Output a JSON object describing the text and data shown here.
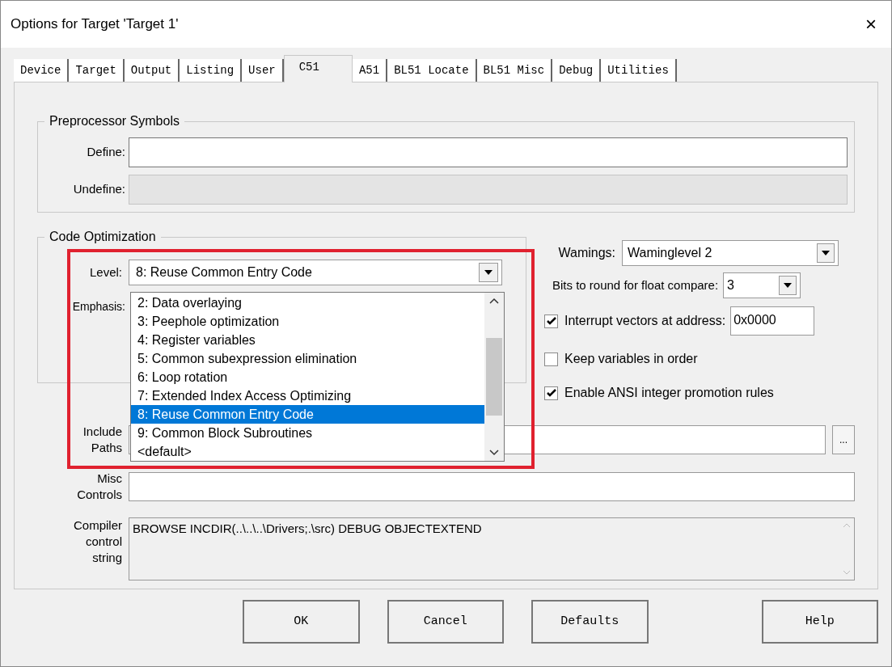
{
  "window": {
    "title": "Options for Target 'Target 1'",
    "close": "×"
  },
  "tabs": [
    {
      "label": "Device",
      "selected": false
    },
    {
      "label": "Target",
      "selected": false
    },
    {
      "label": "Output",
      "selected": false
    },
    {
      "label": "Listing",
      "selected": false
    },
    {
      "label": "User",
      "selected": false
    },
    {
      "label": "C51",
      "selected": true
    },
    {
      "label": "A51",
      "selected": false
    },
    {
      "label": "BL51 Locate",
      "selected": false
    },
    {
      "label": "BL51 Misc",
      "selected": false
    },
    {
      "label": "Debug",
      "selected": false
    },
    {
      "label": "Utilities",
      "selected": false
    }
  ],
  "preprocessor": {
    "title": "Preprocessor Symbols",
    "fields": [
      {
        "label": "Define:",
        "disabled": false
      },
      {
        "label": "Undefine:",
        "disabled": true
      }
    ]
  },
  "code_optimization": {
    "title": "Code Optimization",
    "level": {
      "label": "Level:",
      "value": "8: Reuse Common Entry Code"
    },
    "emphasis": {
      "label": "Emphasis:"
    },
    "dropdown": [
      {
        "label": "2: Data overlaying",
        "selected": false
      },
      {
        "label": "3: Peephole optimization",
        "selected": false
      },
      {
        "label": "4: Register variables",
        "selected": false
      },
      {
        "label": "5: Common subexpression elimination",
        "selected": false
      },
      {
        "label": "6: Loop rotation",
        "selected": false
      },
      {
        "label": "7: Extended Index Access Optimizing",
        "selected": false
      },
      {
        "label": "8: Reuse Common Entry Code",
        "selected": true
      },
      {
        "label": "9: Common Block Subroutines",
        "selected": false
      },
      {
        "label": "<default>",
        "selected": false
      }
    ]
  },
  "warnings": {
    "label": "Wamings:",
    "value": "Waminglevel 2"
  },
  "bits": {
    "label": "Bits to round for float compare:",
    "value": "3"
  },
  "options": [
    {
      "kind": "checkbox-field",
      "label": "Interrupt vectors at address:",
      "checked": true,
      "value": "0x0000"
    },
    {
      "kind": "checkbox",
      "label": "Keep variables in order",
      "checked": false
    },
    {
      "kind": "checkbox",
      "label": "Enable ANSI integer promotion rules",
      "checked": true
    }
  ],
  "include_paths": {
    "label": [
      "Include",
      "Paths"
    ],
    "browse": "..."
  },
  "misc_controls": {
    "label": [
      "Misc",
      "Controls"
    ]
  },
  "compiler_control": {
    "label": [
      "Compiler",
      "control",
      "string"
    ],
    "value": "BROWSE INCDIR(..\\..\\..\\Drivers;.\\src) DEBUG OBJECTEXTEND",
    "disabled": true
  },
  "buttons": [
    "OK",
    "Cancel",
    "Defaults",
    "Help"
  ]
}
